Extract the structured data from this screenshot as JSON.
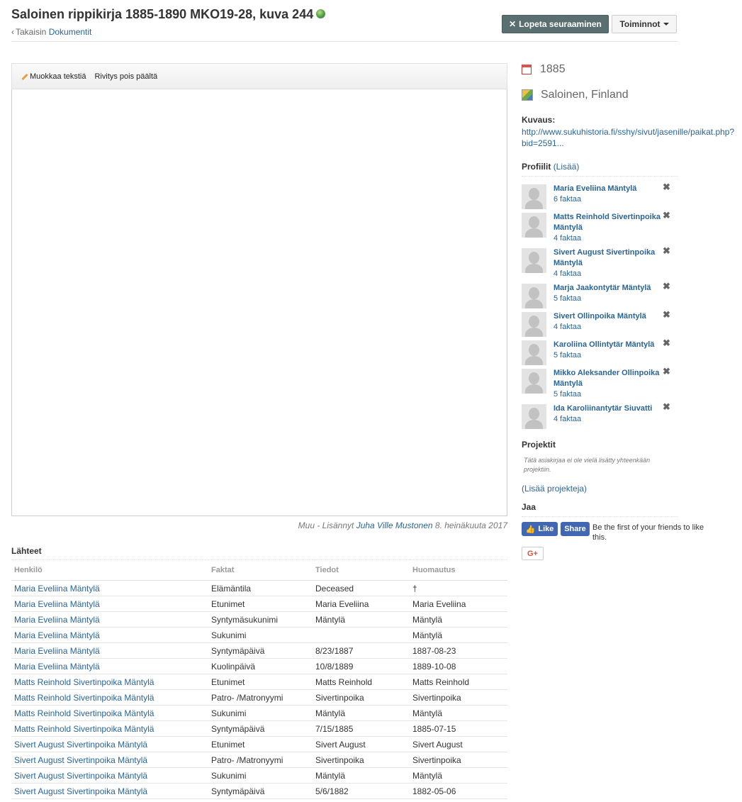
{
  "header": {
    "title": "Saloinen rippikirja 1885-1890 MKO19-28, kuva 244",
    "back_prefix": "Takaisin",
    "back_link": "Dokumentit",
    "stop_following_label": "Lopeta seuraaminen",
    "actions_label": "Toiminnot"
  },
  "viewer": {
    "edit_text_label": "Muokkaa tekstiä",
    "wrap_label": "Rivitys pois päältä",
    "added_prefix": "Muu - Lisännyt",
    "added_by": "Juha Ville Mustonen",
    "added_date": "8. heinäkuuta 2017"
  },
  "sources": {
    "title": "Lähteet",
    "columns": [
      "Henkilö",
      "Faktat",
      "Tiedot",
      "Huomautus"
    ],
    "rows": [
      {
        "person": "Maria Eveliina Mäntylä",
        "fact": "Elämäntila",
        "info": "Deceased",
        "note": "†"
      },
      {
        "person": "Maria Eveliina Mäntylä",
        "fact": "Etunimet",
        "info": "Maria Eveliina",
        "note": "Maria Eveliina"
      },
      {
        "person": "Maria Eveliina Mäntylä",
        "fact": "Syntymäsukunimi",
        "info": "Mäntylä",
        "note": "Mäntylä"
      },
      {
        "person": "Maria Eveliina Mäntylä",
        "fact": "Sukunimi",
        "info": "",
        "note": "Mäntylä"
      },
      {
        "person": "Maria Eveliina Mäntylä",
        "fact": "Syntymäpäivä",
        "info": "8/23/1887",
        "note": "1887-08-23"
      },
      {
        "person": "Maria Eveliina Mäntylä",
        "fact": "Kuolinpäivä",
        "info": "10/8/1889",
        "note": "1889-10-08"
      },
      {
        "person": "Matts Reinhold Sivertinpoika Mäntylä",
        "fact": "Etunimet",
        "info": "Matts Reinhold",
        "note": "Matts Reinhold"
      },
      {
        "person": "Matts Reinhold Sivertinpoika Mäntylä",
        "fact": "Patro- /Matronyymi",
        "info": "Sivertinpoika",
        "note": "Sivertinpoika"
      },
      {
        "person": "Matts Reinhold Sivertinpoika Mäntylä",
        "fact": "Sukunimi",
        "info": "Mäntylä",
        "note": "Mäntylä"
      },
      {
        "person": "Matts Reinhold Sivertinpoika Mäntylä",
        "fact": "Syntymäpäivä",
        "info": "7/15/1885",
        "note": "1885-07-15"
      },
      {
        "person": "Sivert August Sivertinpoika Mäntylä",
        "fact": "Etunimet",
        "info": "Sivert August",
        "note": "Sivert August"
      },
      {
        "person": "Sivert August Sivertinpoika Mäntylä",
        "fact": "Patro- /Matronyymi",
        "info": "Sivertinpoika",
        "note": "Sivertinpoika"
      },
      {
        "person": "Sivert August Sivertinpoika Mäntylä",
        "fact": "Sukunimi",
        "info": "Mäntylä",
        "note": "Mäntylä"
      },
      {
        "person": "Sivert August Sivertinpoika Mäntylä",
        "fact": "Syntymäpäivä",
        "info": "5/6/1882",
        "note": "1882-05-06"
      }
    ]
  },
  "sidebar": {
    "year": "1885",
    "place": "Saloinen, Finland",
    "description_label": "Kuvaus:",
    "description_link": "http://www.sukuhistoria.fi/sshy/sivut/jasenille/paikat.php?bid=2591...",
    "profiles_title": "Profiilit",
    "profiles_add": "(Lisää)",
    "profiles": [
      {
        "name": "Maria Eveliina Mäntylä",
        "facts": "6 faktaa"
      },
      {
        "name": "Matts Reinhold Sivertinpoika Mäntylä",
        "facts": "4 faktaa"
      },
      {
        "name": "Sivert August Sivertinpoika Mäntylä",
        "facts": "4 faktaa"
      },
      {
        "name": "Marja Jaakontytär Mäntylä",
        "facts": "5 faktaa"
      },
      {
        "name": "Sivert Ollinpoika Mäntylä",
        "facts": "4 faktaa"
      },
      {
        "name": "Karoliina Ollintytär Mäntylä",
        "facts": "5 faktaa"
      },
      {
        "name": "Mikko Aleksander Ollinpoika Mäntylä",
        "facts": "5 faktaa"
      },
      {
        "name": "Ida Karoliinantytär Siuvatti",
        "facts": "4 faktaa"
      }
    ],
    "projects_title": "Projektit",
    "projects_note": "Tätä asiakirjaa ei ole vielä lisätty yhteenkään projektiin.",
    "projects_add": "(Lisää projekteja)",
    "share_title": "Jaa",
    "fb_like": "Like",
    "fb_share": "Share",
    "fb_text": "Be the first of your friends to like this.",
    "gplus": "G+"
  },
  "colors": {
    "link": "#2a6496",
    "stop_button_bg": "#5a7070",
    "facebook": "#4267b2",
    "google_plus": "#dd4b39"
  },
  "icons": [
    "globe-icon",
    "chevron-left-icon",
    "close-icon",
    "caret-down-icon",
    "pencil-icon",
    "calendar-icon",
    "map-icon",
    "avatar-placeholder-icon",
    "remove-icon",
    "thumbs-up-icon"
  ]
}
